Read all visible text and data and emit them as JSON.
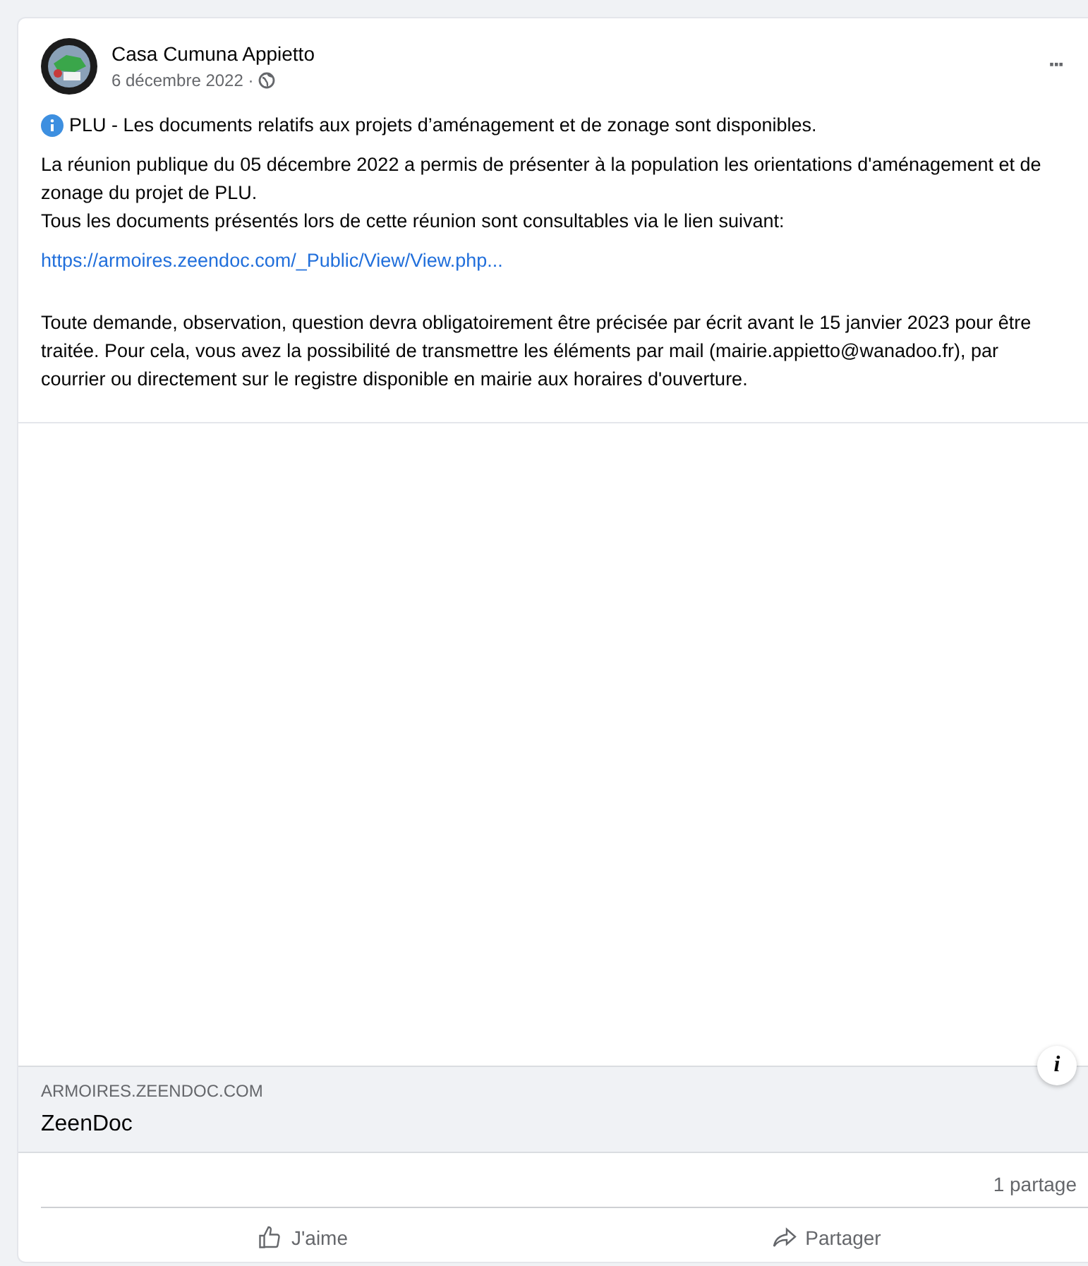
{
  "post": {
    "author": "Casa Cumuna Appietto",
    "date": "6 décembre 2022 ·",
    "more": "···",
    "headline": "PLU - Les documents relatifs aux projets d’aménagement et de zonage sont disponibles.",
    "paragraph_1": [
      "La réunion publique du 05 décembre 2022 a permis de présenter à la population les orientations d'aménagement et de zonage du projet de PLU.",
      "Tous les documents présentés lors de cette réunion sont consultables via le lien suivant:"
    ],
    "link": "https://armoires.zeendoc.com/_Public/View/View.php...",
    "paragraph_2": "Toute demande, observation, question devra obligatoirement être précisée par écrit avant le 15 janvier 2023 pour être traitée. Pour cela, vous avez la possibilité de transmettre les éléments par mail (mairie.appietto@wanadoo.fr), par courrier ou directement sur le registre disponible en mairie aux horaires d'ouverture."
  },
  "link_preview": {
    "domain": "ARMOIRES.ZEENDOC.COM",
    "title": "ZeenDoc",
    "info": "i"
  },
  "stats": {
    "shares": "1 partage"
  },
  "actions": [
    {
      "kind": "like",
      "label": "J'aime"
    },
    {
      "kind": "share",
      "label": "Partager"
    }
  ]
}
